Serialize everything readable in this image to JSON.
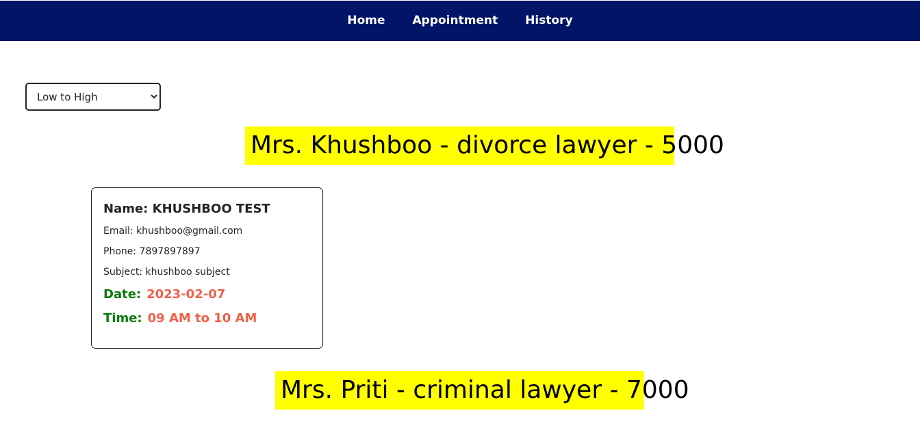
{
  "nav": {
    "items": [
      {
        "label": "Home"
      },
      {
        "label": "Appointment"
      },
      {
        "label": "History"
      }
    ]
  },
  "sort": {
    "selected": "Low to High",
    "options": [
      "Low to High"
    ]
  },
  "lawyers": [
    {
      "heading": "Mrs. Khushboo - divorce lawyer - 5000"
    },
    {
      "heading": "Mrs. Priti - criminal lawyer - 7000"
    }
  ],
  "appointment": {
    "name": "Name: KHUSHBOO TEST",
    "email": "Email: khushboo@gmail.com",
    "phone": "Phone: 7897897897",
    "subject": "Subject: khushboo subject",
    "date_label": "Date:",
    "date_value": "2023-02-07",
    "time_label": "Time:",
    "time_value": "09 AM to 10 AM"
  },
  "colors": {
    "navbar": "#021466",
    "heading_highlight": "#ffff00",
    "label_green": "#0a7d0a",
    "value_coral": "#f0614a"
  }
}
